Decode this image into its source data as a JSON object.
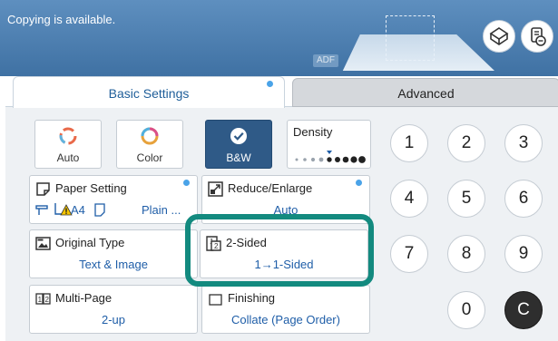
{
  "header": {
    "status_text": "Copying is available.",
    "adf_label": "ADF"
  },
  "tabs": [
    {
      "label": "Basic Settings",
      "active": true
    },
    {
      "label": "Advanced",
      "active": false
    }
  ],
  "color_modes": [
    {
      "label": "Auto",
      "selected": false
    },
    {
      "label": "Color",
      "selected": false
    },
    {
      "label": "B&W",
      "selected": true
    }
  ],
  "density": {
    "label": "Density",
    "level": 5,
    "steps": 9
  },
  "settings": {
    "paper_setting": {
      "title": "Paper Setting",
      "size": "A4",
      "type": "Plain ..."
    },
    "reduce_enlarge": {
      "title": "Reduce/Enlarge",
      "value": "Auto"
    },
    "original_type": {
      "title": "Original Type",
      "value": "Text & Image"
    },
    "two_sided": {
      "title": "2-Sided",
      "value": "1→1-Sided"
    },
    "multi_page": {
      "title": "Multi-Page",
      "value": "2-up"
    },
    "finishing": {
      "title": "Finishing",
      "value": "Collate (Page Order)"
    }
  },
  "keypad": {
    "keys": [
      "1",
      "2",
      "3",
      "4",
      "5",
      "6",
      "7",
      "8",
      "9",
      "0"
    ],
    "clear": "C"
  },
  "colors": {
    "header": "#4a7db0",
    "selected_mode": "#2f5a87",
    "value_text": "#1f5ea8",
    "highlight": "#138a7f"
  }
}
